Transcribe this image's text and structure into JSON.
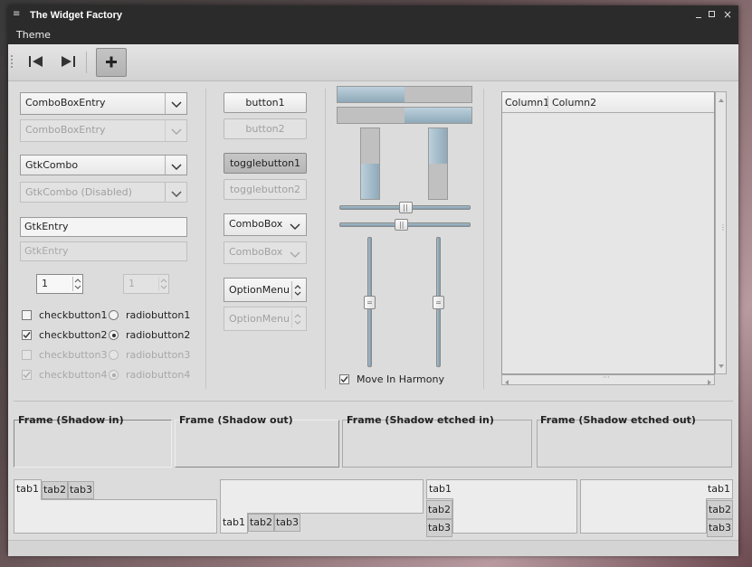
{
  "window": {
    "title": "The Widget Factory"
  },
  "menubar": {
    "items": [
      "Theme"
    ]
  },
  "toolbar": {
    "icons": [
      "go-first-icon",
      "go-last-icon",
      "add-icon"
    ]
  },
  "col1": {
    "combo_entry": "ComboBoxEntry",
    "combo_entry_disabled": "ComboBoxEntry",
    "gtk_combo": "GtkCombo",
    "gtk_combo_disabled": "GtkCombo (Disabled)",
    "entry": "GtkEntry",
    "entry_disabled": "GtkEntry",
    "spin_value": "1",
    "spin_value_disabled": "1",
    "checkbuttons": [
      "checkbutton1",
      "checkbutton2",
      "checkbutton3",
      "checkbutton4"
    ],
    "radiobuttons": [
      "radiobutton1",
      "radiobutton2",
      "radiobutton3",
      "radiobutton4"
    ]
  },
  "col2": {
    "button1": "button1",
    "button2": "button2",
    "togglebutton1": "togglebutton1",
    "togglebutton2": "togglebutton2",
    "combobox": "ComboBox",
    "combobox_disabled": "ComboBox",
    "optionmenu": "OptionMenu",
    "optionmenu_disabled": "OptionMenu"
  },
  "col3": {
    "hprogress": [
      0.5,
      0.5
    ],
    "vprogress": [
      0.5,
      0.5
    ],
    "hscale": [
      0.5,
      0.47
    ],
    "vscale": [
      0.5,
      0.5
    ],
    "move_in_harmony": "Move In Harmony"
  },
  "treeview": {
    "columns": [
      "Column1",
      "Column2"
    ]
  },
  "frames": [
    "Frame (Shadow in)",
    "Frame (Shadow out)",
    "Frame (Shadow etched in)",
    "Frame (Shadow etched out)"
  ],
  "notebooks": {
    "tabs": [
      "tab1",
      "tab2",
      "tab3"
    ]
  },
  "colors": {
    "titlebar": "#2b2b2b",
    "window_bg": "#dcdcdc",
    "progress_fill": "#9fb8c8"
  }
}
